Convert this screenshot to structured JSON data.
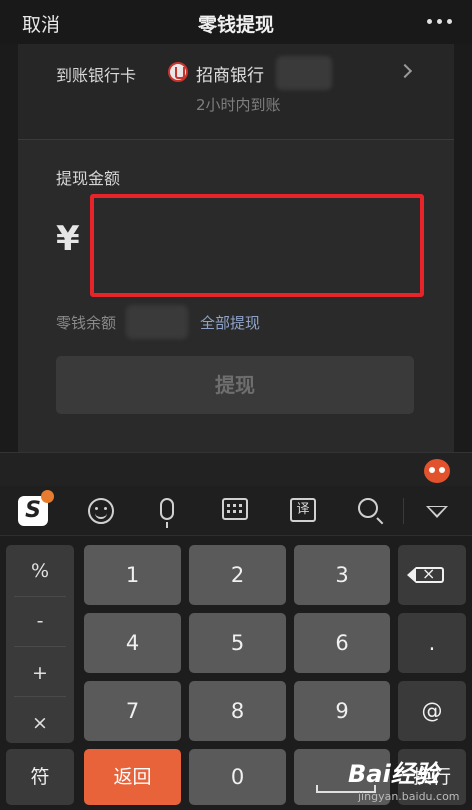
{
  "nav": {
    "cancel": "取消",
    "title": "零钱提现",
    "more_icon": "more-dots-icon"
  },
  "bank": {
    "label": "到账银行卡",
    "bank_name": "招商银行",
    "arrival_note": "2小时内到账",
    "logo_icon": "cmb-bank-logo-icon"
  },
  "withdraw": {
    "amount_label": "提现金额",
    "currency": "¥",
    "amount_value": "",
    "balance_label": "零钱余额",
    "withdraw_all": "全部提现",
    "submit": "提现"
  },
  "keyboard": {
    "toolbar": [
      "sogou-logo-icon",
      "emoji-icon",
      "microphone-icon",
      "keyboard-icon",
      "translate-icon",
      "search-icon",
      "collapse-keyboard-icon"
    ],
    "translate_glyph": "译",
    "symbols": [
      "%",
      "-",
      "+",
      "×"
    ],
    "digits": [
      "1",
      "2",
      "3",
      "4",
      "5",
      "6",
      "7",
      "8",
      "9",
      "0"
    ],
    "dot": ".",
    "at": "@",
    "sym_key": "符",
    "back_key": "返回",
    "enter_key": "换行"
  },
  "watermark": {
    "text": "Bai经验",
    "sub": "jingyan.baidu.com"
  },
  "colors": {
    "highlight_border": "#e8232a",
    "link": "#8fa3c8",
    "orange_key": "#e8623a"
  }
}
